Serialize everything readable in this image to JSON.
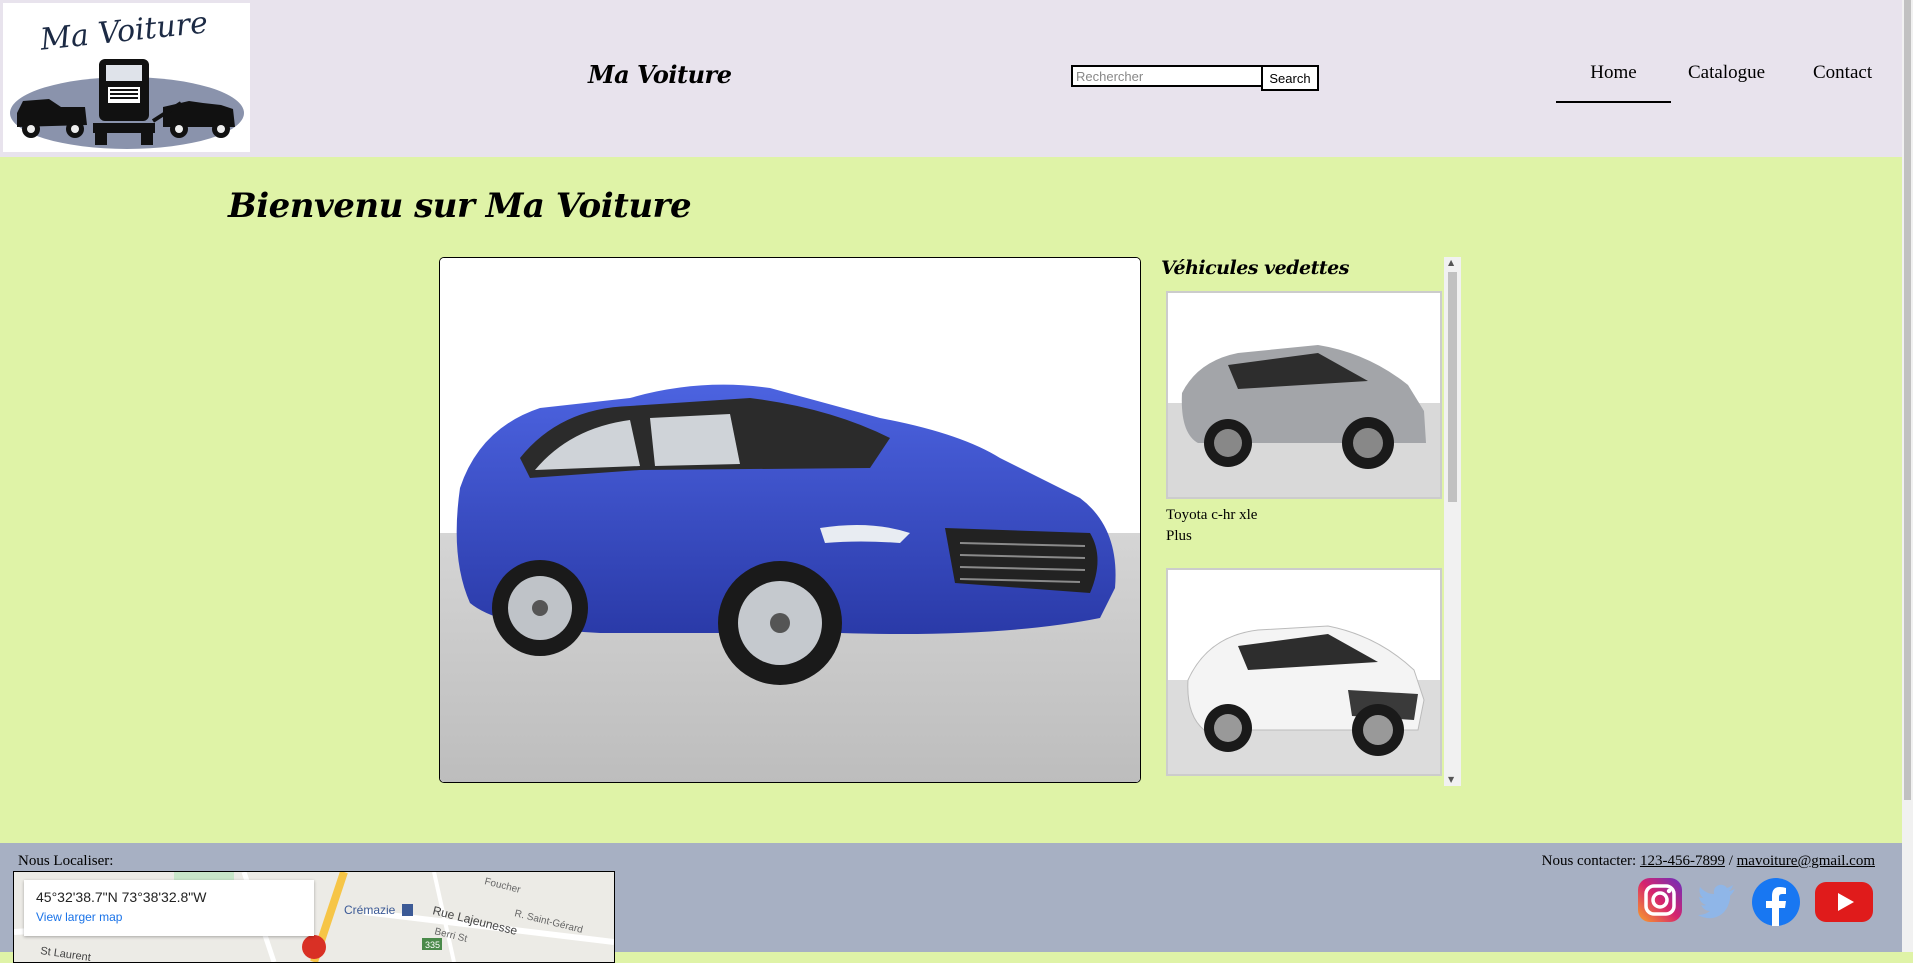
{
  "header": {
    "logo_text": "Ma Voiture",
    "brand": "Ma Voiture",
    "search": {
      "placeholder": "Rechercher",
      "button_label": "Search"
    },
    "nav": [
      {
        "label": "Home",
        "active": true
      },
      {
        "label": "Catalogue",
        "active": false
      },
      {
        "label": "Contact",
        "active": false
      }
    ]
  },
  "main": {
    "title": "Bienvenu sur Ma Voiture",
    "featured": {
      "heading": "Véhicules vedettes",
      "items": [
        {
          "name": "Toyota c-hr xle",
          "link": "Plus",
          "color": "#9a9ca0"
        },
        {
          "name": "",
          "link": "",
          "color": "#f2f2f2"
        }
      ]
    },
    "hero_car_color": "#3a4fc9"
  },
  "footer": {
    "location_label": "Nous Localiser:",
    "map": {
      "coords": "45°32'38.7\"N 73°38'32.8\"W",
      "larger_link": "View larger map",
      "labels": [
        "Crémazie",
        "Rue Lajeunesse",
        "Berri St",
        "R. Saint-Gérard",
        "Foucher",
        "335",
        "St Laurent"
      ]
    },
    "contact_label": "Nous contacter:",
    "phone": "123-456-7899",
    "separator": "/",
    "email": "mavoiture@gmail.com",
    "socials": [
      "instagram-icon",
      "twitter-icon",
      "facebook-icon",
      "youtube-icon"
    ]
  },
  "colors": {
    "header_bg": "#e8e3ed",
    "main_bg": "#dff3a7",
    "footer_bg": "#a7b0c3"
  }
}
